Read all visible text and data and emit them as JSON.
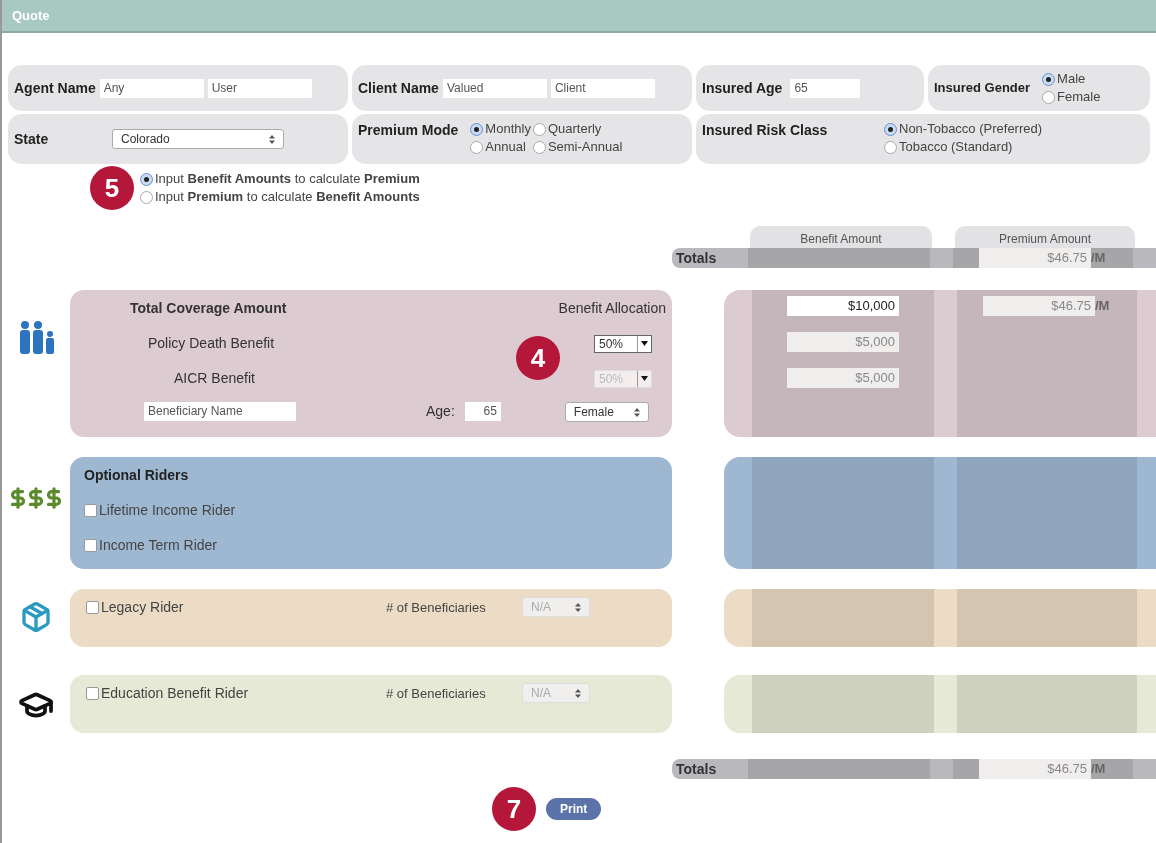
{
  "header": {
    "title": "Quote"
  },
  "agent": {
    "label": "Agent Name",
    "first": "Any",
    "last": "User"
  },
  "client": {
    "label": "Client Name",
    "first": "Valued",
    "last": "Client"
  },
  "insured_age": {
    "label": "Insured Age",
    "value": "65"
  },
  "insured_gender": {
    "label": "Insured Gender",
    "options": [
      {
        "label": "Male",
        "selected": true
      },
      {
        "label": "Female",
        "selected": false
      }
    ]
  },
  "state": {
    "label": "State",
    "value": "Colorado"
  },
  "premium_mode": {
    "label": "Premium Mode",
    "options": [
      {
        "label": "Monthly",
        "selected": true
      },
      {
        "label": "Quarterly",
        "selected": false
      },
      {
        "label": "Annual",
        "selected": false
      },
      {
        "label": "Semi-Annual",
        "selected": false
      }
    ]
  },
  "risk_class": {
    "label": "Insured Risk Class",
    "options": [
      {
        "label": "Non-Tobacco (Preferred)",
        "selected": true
      },
      {
        "label": "Tobacco (Standard)",
        "selected": false
      }
    ]
  },
  "calc_mode": {
    "badge": "5",
    "options": [
      {
        "label": "Input **Benefit Amounts** to calculate **Premium**",
        "selected": true
      },
      {
        "label": "Input **Premium** to calculate **Benefit Amounts**",
        "selected": false
      }
    ]
  },
  "columns": [
    "Benefit Amount",
    "Premium Amount"
  ],
  "totals_top": {
    "label": "Totals",
    "premium": "$46.75",
    "unit": "/M"
  },
  "coverage": {
    "title": "Total Coverage Amount",
    "allocation_label": "Benefit Allocation",
    "badge": "4",
    "total_amount": "$10,000",
    "premium": "$46.75",
    "unit": "/M",
    "rows": [
      {
        "label": "Policy Death Benefit",
        "allocation": "50%",
        "disabled": false,
        "amount": "$5,000"
      },
      {
        "label": "AICR Benefit",
        "allocation": "50%",
        "disabled": true,
        "amount": "$5,000"
      }
    ],
    "beneficiary_placeholder": "Beneficiary Name",
    "age_label": "Age:",
    "age": "65",
    "gender": "Female"
  },
  "riders": {
    "title": "Optional Riders",
    "items": [
      {
        "label": "Lifetime Income Rider",
        "checked": false
      },
      {
        "label": "Income Term Rider",
        "checked": false
      }
    ]
  },
  "legacy": {
    "label": "Legacy Rider",
    "checked": false,
    "beneficiaries_label": "# of Beneficiaries",
    "beneficiaries": "N/A"
  },
  "education": {
    "label": "Education Benefit Rider",
    "checked": false,
    "beneficiaries_label": "# of Beneficiaries",
    "beneficiaries": "N/A"
  },
  "totals_bottom": {
    "label": "Totals",
    "premium": "$46.75",
    "unit": "/M"
  },
  "print": {
    "badge": "7",
    "label": "Print"
  }
}
